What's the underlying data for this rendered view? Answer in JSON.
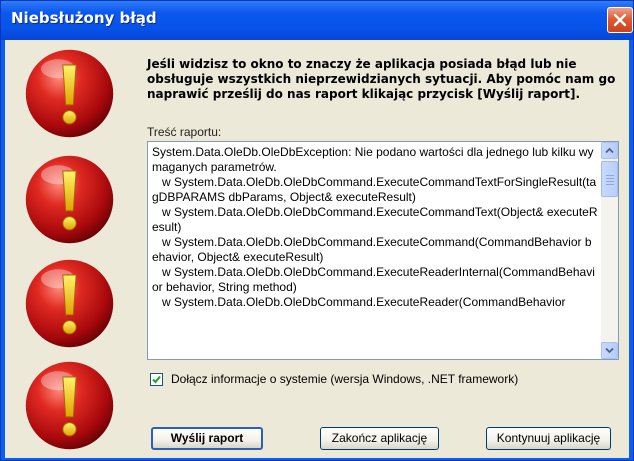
{
  "window": {
    "title": "Niebsłużony błąd",
    "close_icon": "close-icon"
  },
  "message": "Jeśli widzisz to okno to znaczy że aplikacja posiada błąd lub nie obsługuje wszystkich nieprzewidzianych sytuacji. Aby pomóc nam go naprawić prześlij do nas raport klikając przycisk [Wyślij raport].",
  "report": {
    "label": "Treść raportu:",
    "text": "System.Data.OleDb.OleDbException: Nie podano wartości dla jednego lub kilku wymaganych parametrów.\n   w System.Data.OleDb.OleDbCommand.ExecuteCommandTextForSingleResult(tagDBPARAMS dbParams, Object& executeResult)\n   w System.Data.OleDb.OleDbCommand.ExecuteCommandText(Object& executeResult)\n   w System.Data.OleDb.OleDbCommand.ExecuteCommand(CommandBehavior behavior, Object& executeResult)\n   w System.Data.OleDb.OleDbCommand.ExecuteReaderInternal(CommandBehavior behavior, String method)\n   w System.Data.OleDb.OleDbCommand.ExecuteReader(CommandBehavior"
  },
  "include_system_info": {
    "checked": true,
    "label": "Dołącz informacje o systemie (wersja Windows, .NET framework)"
  },
  "buttons": {
    "send": "Wyślij raport",
    "quit": "Zakończ aplikację",
    "continue": "Kontynuuj aplikację"
  },
  "colors": {
    "titlebar": "#0b58f0",
    "client_bg": "#ece9d8",
    "warning_red": "#c4161c"
  },
  "icons": [
    "warning-icon",
    "warning-icon",
    "warning-icon",
    "warning-icon"
  ]
}
